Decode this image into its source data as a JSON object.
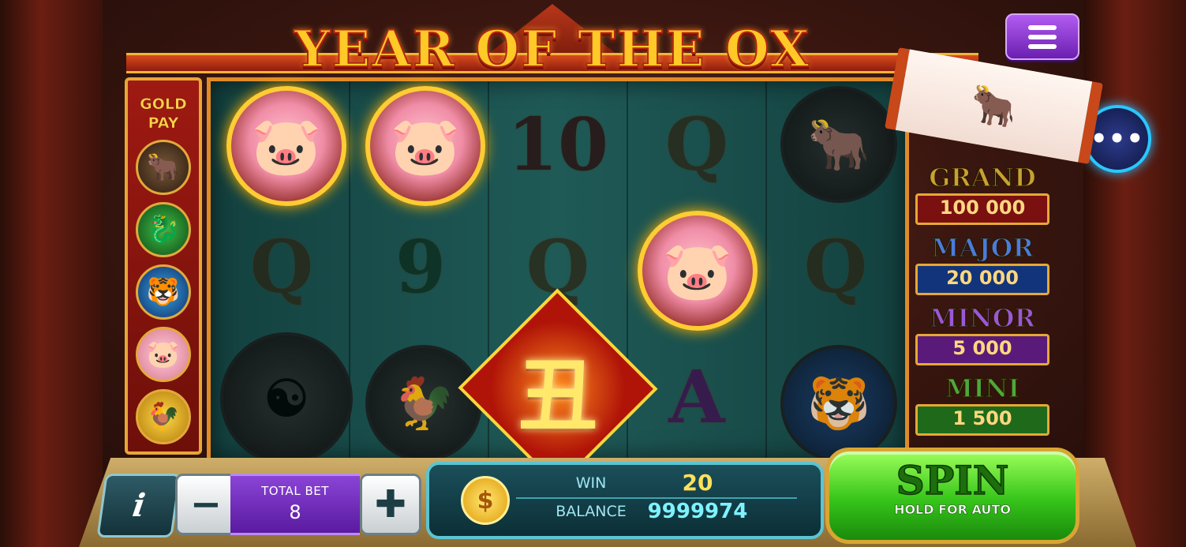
{
  "game": {
    "title": "YEAR OF THE OX"
  },
  "goldpay": {
    "title_line1": "GOLD",
    "title_line2": "PAY",
    "icons": [
      "ox-icon",
      "dragon-icon",
      "tiger-icon",
      "pig-icon",
      "rooster-icon"
    ]
  },
  "reels": [
    [
      "pig",
      "Q",
      "yin-yang"
    ],
    [
      "pig",
      "9",
      "rooster"
    ],
    [
      "10",
      "Q",
      "wild"
    ],
    [
      "Q",
      "pig",
      "A"
    ],
    [
      "ox",
      "Q",
      "tiger"
    ]
  ],
  "jackpots": [
    {
      "name": "GRAND",
      "value": "100 000"
    },
    {
      "name": "MAJOR",
      "value": "20 000"
    },
    {
      "name": "MINOR",
      "value": "5 000"
    },
    {
      "name": "MINI",
      "value": "1 500"
    }
  ],
  "bet": {
    "label": "TOTAL BET",
    "value": "8",
    "minus": "−",
    "plus": "✚",
    "info": "i"
  },
  "status": {
    "win_label": "WIN",
    "win_value": "20",
    "balance_label": "BALANCE",
    "balance_value": "9999974",
    "coin_symbol": "$"
  },
  "spin": {
    "label": "SPIN",
    "sub_label": "HOLD FOR AUTO"
  },
  "more_label": "•••",
  "colors": {
    "reel_bg": "#1f5a57",
    "frame": "#e18a27",
    "spin_green": "#36c41a",
    "menu_purple": "#8a3ad6"
  }
}
